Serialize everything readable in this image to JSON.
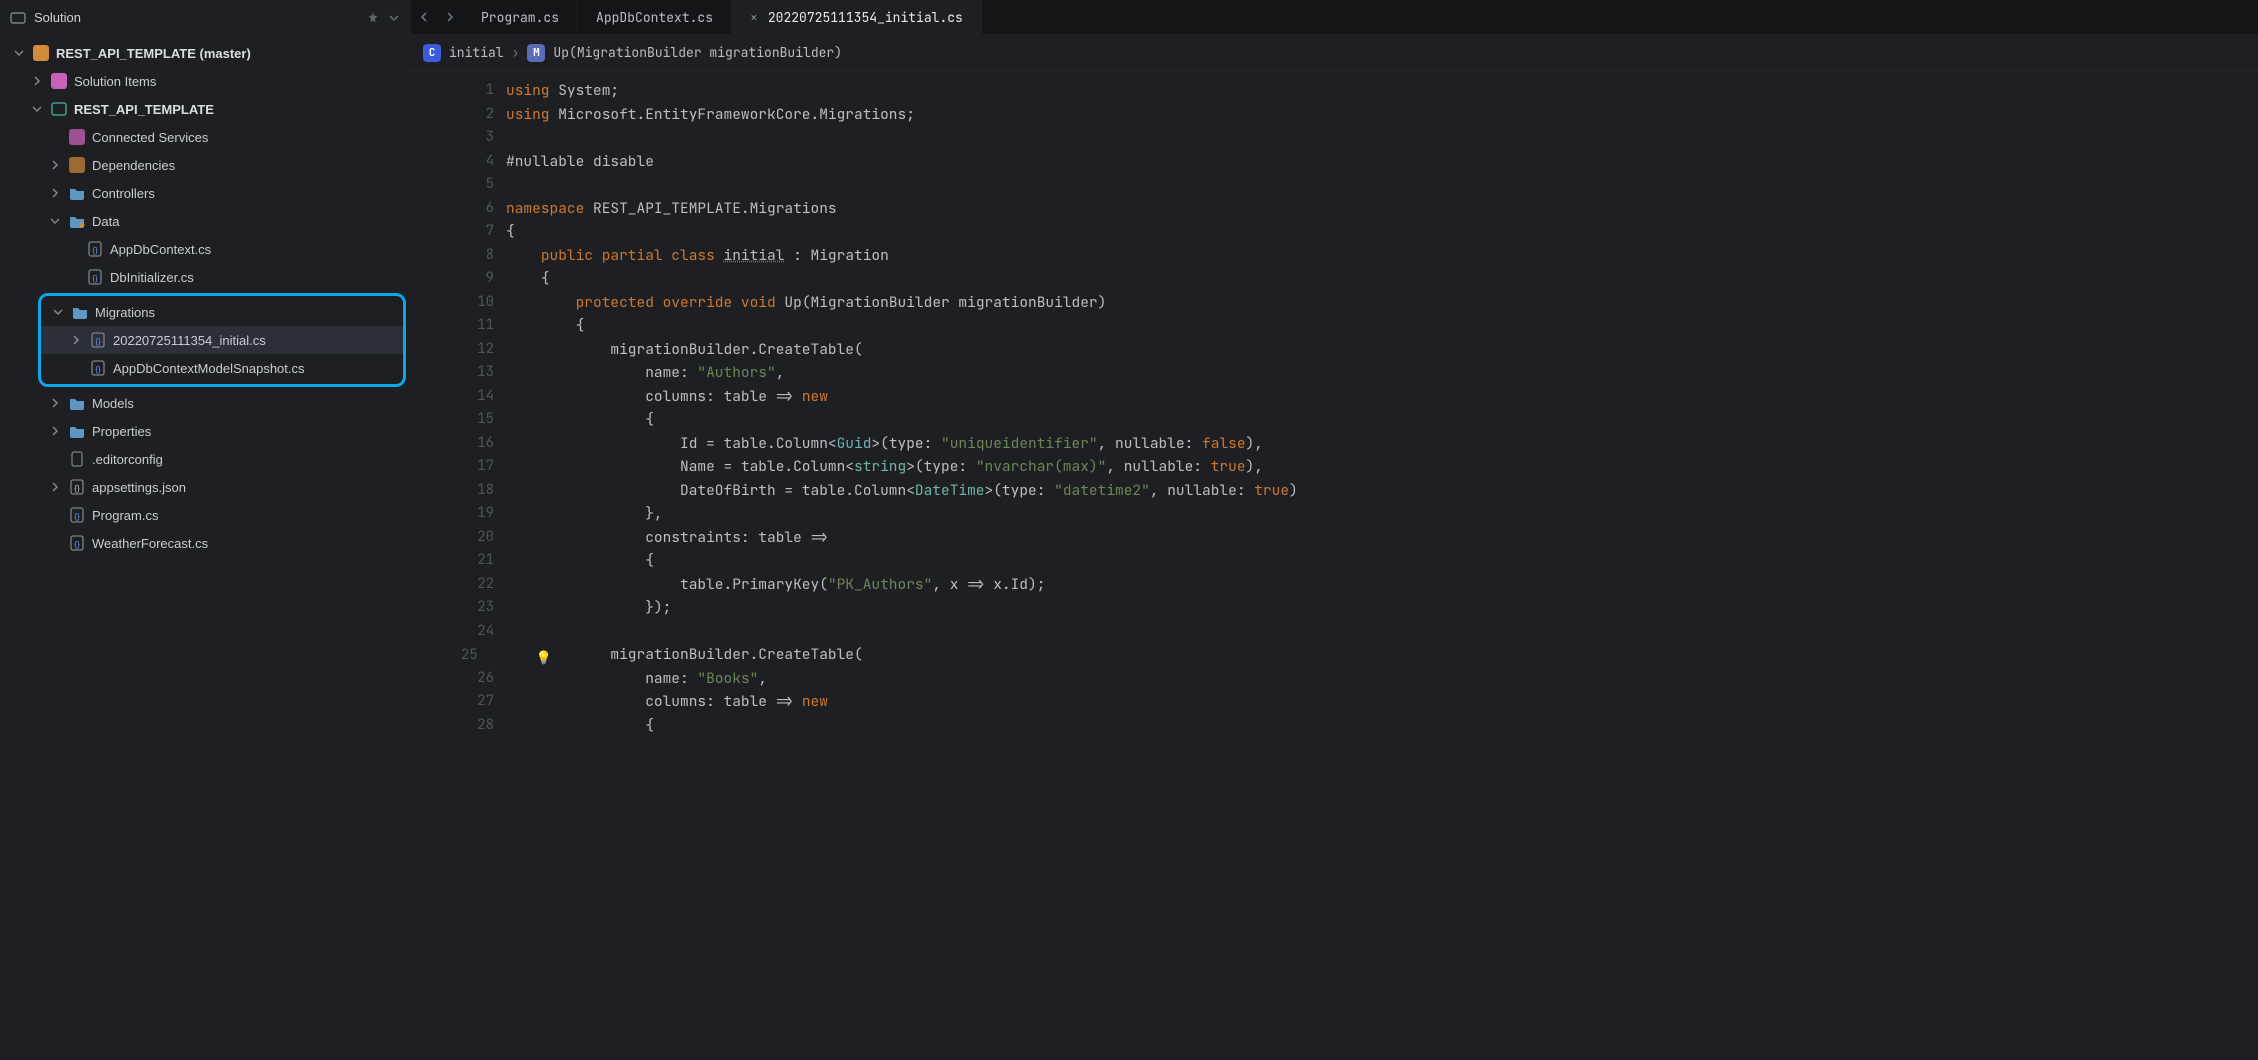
{
  "sidebar": {
    "title": "Solution",
    "root": {
      "label": "REST_API_TEMPLATE (master)",
      "items": [
        {
          "label": "Solution Items",
          "icon": "folder-pink"
        },
        {
          "label": "REST_API_TEMPLATE",
          "bold": true,
          "icon": "csproj",
          "items": [
            {
              "label": "Connected Services",
              "icon": "services"
            },
            {
              "label": "Dependencies",
              "icon": "deps",
              "expandable": true
            },
            {
              "label": "Controllers",
              "icon": "folder",
              "expandable": true
            },
            {
              "label": "Data",
              "icon": "folder-dot",
              "expanded": true,
              "items": [
                {
                  "label": "AppDbContext.cs",
                  "icon": "cs"
                },
                {
                  "label": "DbInitializer.cs",
                  "icon": "cs"
                }
              ]
            },
            {
              "label": "Migrations",
              "icon": "folder",
              "expanded": true,
              "highlight": true,
              "items": [
                {
                  "label": "20220725111354_initial.cs",
                  "icon": "cs",
                  "selected": true,
                  "expandable": true
                },
                {
                  "label": "AppDbContextModelSnapshot.cs",
                  "icon": "cs"
                }
              ]
            },
            {
              "label": "Models",
              "icon": "folder",
              "expandable": true
            },
            {
              "label": "Properties",
              "icon": "folder",
              "expandable": true
            },
            {
              "label": ".editorconfig",
              "icon": "file"
            },
            {
              "label": "appsettings.json",
              "icon": "json",
              "expandable": true
            },
            {
              "label": "Program.cs",
              "icon": "cs"
            },
            {
              "label": "WeatherForecast.cs",
              "icon": "cs"
            }
          ]
        }
      ]
    }
  },
  "tabs": [
    {
      "label": "Program.cs",
      "active": false
    },
    {
      "label": "AppDbContext.cs",
      "active": false
    },
    {
      "label": "20220725111354_initial.cs",
      "active": true,
      "closable": true
    }
  ],
  "breadcrumb": {
    "c_label": "initial",
    "m_label": "Up(MigrationBuilder migrationBuilder)"
  },
  "chart_data": null,
  "code": {
    "lines": [
      {
        "n": 1,
        "seg": [
          [
            "kw",
            "using"
          ],
          [
            "punct",
            " System;"
          ]
        ]
      },
      {
        "n": 2,
        "seg": [
          [
            "kw",
            "using"
          ],
          [
            "punct",
            " Microsoft.EntityFrameworkCore.Migrations;"
          ]
        ]
      },
      {
        "n": 3,
        "seg": [
          [
            "punct",
            ""
          ]
        ]
      },
      {
        "n": 4,
        "seg": [
          [
            "punct",
            "#nullable disable"
          ]
        ]
      },
      {
        "n": 5,
        "seg": [
          [
            "punct",
            ""
          ]
        ]
      },
      {
        "n": 6,
        "seg": [
          [
            "kw",
            "namespace"
          ],
          [
            "punct",
            " REST_API_TEMPLATE.Migrations"
          ]
        ]
      },
      {
        "n": 7,
        "seg": [
          [
            "punct",
            "{"
          ]
        ]
      },
      {
        "n": 8,
        "seg": [
          [
            "punct",
            "    "
          ],
          [
            "kw",
            "public partial class"
          ],
          [
            "punct",
            " "
          ],
          [
            "underlined",
            "initial"
          ],
          [
            "punct",
            " : Migration"
          ]
        ]
      },
      {
        "n": 9,
        "seg": [
          [
            "punct",
            "    {"
          ]
        ]
      },
      {
        "n": 10,
        "seg": [
          [
            "punct",
            "        "
          ],
          [
            "kw",
            "protected override void"
          ],
          [
            "punct",
            " Up(MigrationBuilder migrationBuilder)"
          ]
        ]
      },
      {
        "n": 11,
        "seg": [
          [
            "punct",
            "        {"
          ]
        ]
      },
      {
        "n": 12,
        "seg": [
          [
            "punct",
            "            migrationBuilder.CreateTable("
          ]
        ]
      },
      {
        "n": 13,
        "seg": [
          [
            "punct",
            "                name: "
          ],
          [
            "str",
            "\"Authors\""
          ],
          [
            "punct",
            ","
          ]
        ]
      },
      {
        "n": 14,
        "seg": [
          [
            "punct",
            "                columns: table => "
          ],
          [
            "kw",
            "new"
          ]
        ]
      },
      {
        "n": 15,
        "seg": [
          [
            "punct",
            "                {"
          ]
        ]
      },
      {
        "n": 16,
        "seg": [
          [
            "punct",
            "                    Id = table.Column<"
          ],
          [
            "ty",
            "Guid"
          ],
          [
            "punct",
            ">(type: "
          ],
          [
            "str",
            "\"uniqueidentifier\""
          ],
          [
            "punct",
            ", nullable: "
          ],
          [
            "bool",
            "false"
          ],
          [
            "punct",
            "),"
          ]
        ]
      },
      {
        "n": 17,
        "seg": [
          [
            "punct",
            "                    Name = table.Column<"
          ],
          [
            "ty",
            "string"
          ],
          [
            "punct",
            ">(type: "
          ],
          [
            "str",
            "\"nvarchar(max)\""
          ],
          [
            "punct",
            ", nullable: "
          ],
          [
            "bool",
            "true"
          ],
          [
            "punct",
            "),"
          ]
        ]
      },
      {
        "n": 18,
        "seg": [
          [
            "punct",
            "                    DateOfBirth = table.Column<"
          ],
          [
            "ty",
            "DateTime"
          ],
          [
            "punct",
            ">(type: "
          ],
          [
            "str",
            "\"datetime2\""
          ],
          [
            "punct",
            ", nullable: "
          ],
          [
            "bool",
            "true"
          ],
          [
            "punct",
            ")"
          ]
        ]
      },
      {
        "n": 19,
        "seg": [
          [
            "punct",
            "                },"
          ]
        ]
      },
      {
        "n": 20,
        "seg": [
          [
            "punct",
            "                constraints: table =>"
          ]
        ]
      },
      {
        "n": 21,
        "seg": [
          [
            "punct",
            "                {"
          ]
        ]
      },
      {
        "n": 22,
        "seg": [
          [
            "punct",
            "                    table.PrimaryKey("
          ],
          [
            "str",
            "\"PK_Authors\""
          ],
          [
            "punct",
            ", x => x.Id);"
          ]
        ]
      },
      {
        "n": 23,
        "seg": [
          [
            "punct",
            "                });"
          ]
        ]
      },
      {
        "n": 24,
        "seg": [
          [
            "punct",
            ""
          ]
        ]
      },
      {
        "n": 25,
        "bulb": true,
        "seg": [
          [
            "punct",
            "            migrationBuilder.CreateTable("
          ]
        ]
      },
      {
        "n": 26,
        "seg": [
          [
            "punct",
            "                name: "
          ],
          [
            "str",
            "\"Books\""
          ],
          [
            "punct",
            ","
          ]
        ]
      },
      {
        "n": 27,
        "seg": [
          [
            "punct",
            "                columns: table => "
          ],
          [
            "kw",
            "new"
          ]
        ]
      },
      {
        "n": 28,
        "seg": [
          [
            "punct",
            "                {"
          ]
        ]
      }
    ]
  }
}
